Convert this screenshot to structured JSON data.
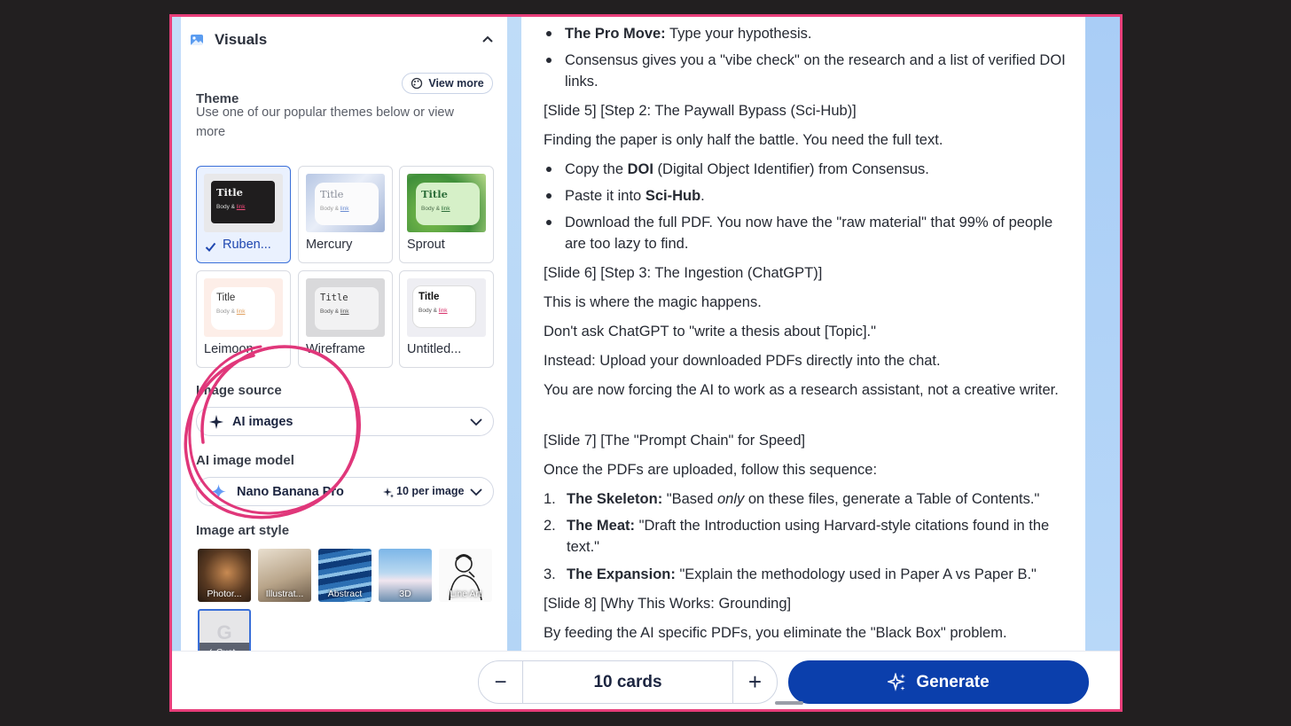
{
  "panel": {
    "section_title": "Visuals",
    "theme_label": "Theme",
    "view_more": "View more",
    "theme_help": "Use one of our popular themes below or view more",
    "themes": [
      {
        "name": "Ruben...",
        "selected": true
      },
      {
        "name": "Mercury",
        "selected": false
      },
      {
        "name": "Sprout",
        "selected": false
      },
      {
        "name": "Leimoon",
        "selected": false
      },
      {
        "name": "Wireframe",
        "selected": false
      },
      {
        "name": "Untitled...",
        "selected": false
      }
    ],
    "theme_preview": {
      "title": "Title",
      "body": "Body &",
      "link": "link"
    },
    "image_source_label": "Image source",
    "image_source_value": "AI images",
    "model_label": "AI image model",
    "model_value": "Nano Banana Pro",
    "model_cost": "10 per image",
    "art_style_label": "Image art style",
    "art_styles": [
      "Photor...",
      "Illustrat...",
      "Abstract",
      "3D",
      "Line Art"
    ],
    "custom_style": "Cust...",
    "custom_letter": "G"
  },
  "doc": {
    "b1_bold": "The Pro Move:",
    "b1_text": " Type your hypothesis.",
    "b2": "Consensus gives you a \"vibe check\" on the research and a list of verified DOI links.",
    "s5": "[Slide 5] [Step 2: The Paywall Bypass (Sci-Hub)]",
    "p5": "Finding the paper is only half the battle. You need the full text.",
    "b3_pre": "Copy the ",
    "b3_bold": "DOI",
    "b3_post": " (Digital Object Identifier) from Consensus.",
    "b4_pre": "Paste it into ",
    "b4_bold": "Sci-Hub",
    "b4_post": ".",
    "b5": "Download the full PDF. You now have the \"raw material\" that 99% of people are too lazy to find.",
    "s6": "[Slide 6] [Step 3: The Ingestion (ChatGPT)]",
    "p6a": "This is where the magic happens.",
    "p6b": "Don't ask ChatGPT to \"write a thesis about [Topic].\"",
    "p6c": "Instead: Upload your downloaded PDFs directly into the chat.",
    "p6d": "You are now forcing the AI to work as a research assistant, not a creative writer.",
    "s7": "[Slide 7] [The \"Prompt Chain\" for Speed]",
    "p7": "Once the PDFs are uploaded, follow this sequence:",
    "n1_num": "1.",
    "n1_bold": "The Skeleton:",
    "n1_pre": " \"Based ",
    "n1_em": "only",
    "n1_post": " on these files, generate a Table of Contents.\"",
    "n2_num": "2.",
    "n2_bold": "The Meat:",
    "n2_text": " \"Draft the Introduction using Harvard-style citations found in the text.\"",
    "n3_num": "3.",
    "n3_bold": "The Expansion:",
    "n3_text": " \"Explain the methodology used in Paper A vs Paper B.\"",
    "s8": "[Slide 8] [Why This Works: Grounding]",
    "p8": "By feeding the AI specific PDFs, you eliminate the \"Black Box\" problem."
  },
  "bottom": {
    "minus": "−",
    "cards": "10 cards",
    "plus": "+",
    "generate": "Generate"
  },
  "colors": {
    "accent": "#0b3fac",
    "annotation": "#e83e7a",
    "selected_border": "#3a6fd8"
  }
}
